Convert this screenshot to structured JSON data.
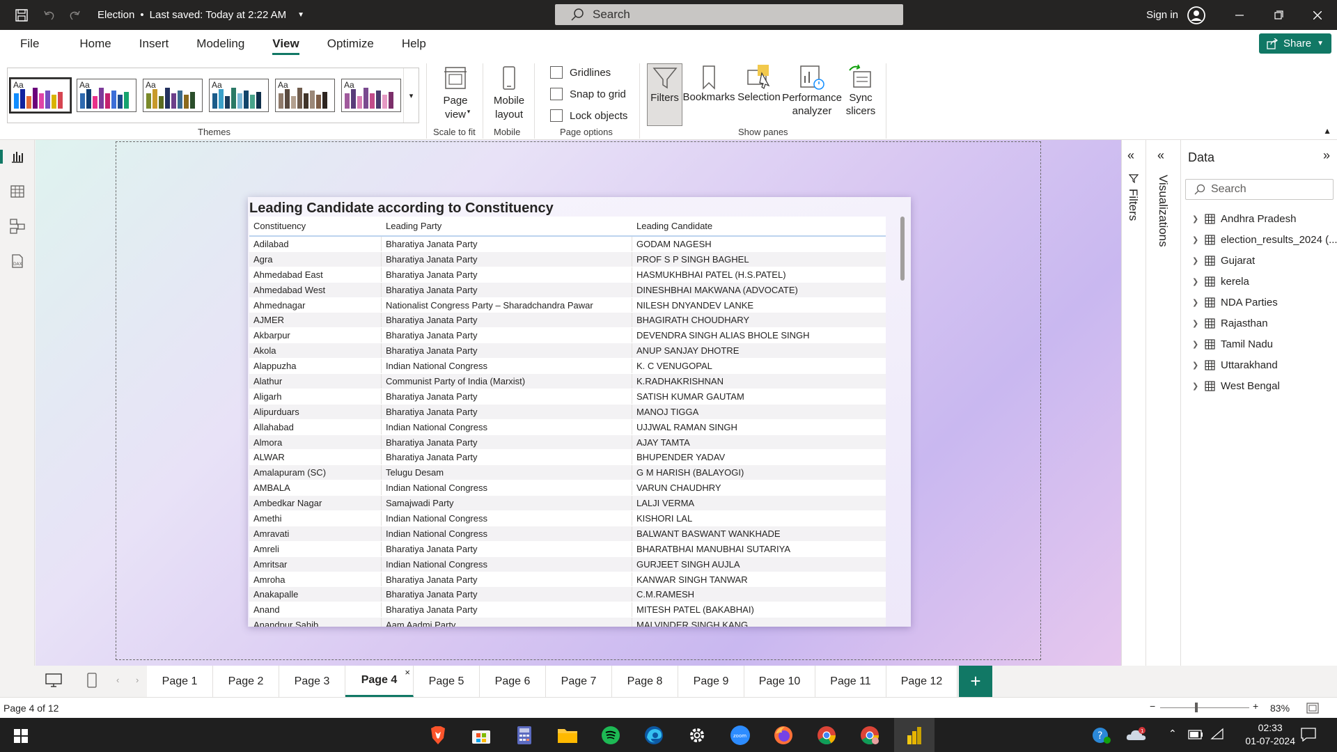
{
  "titlebar": {
    "title": "Election",
    "saved": "Last saved: Today at 2:22 AM",
    "search_placeholder": "Search",
    "signin": "Sign in"
  },
  "menu": {
    "items": [
      "File",
      "Home",
      "Insert",
      "Modeling",
      "View",
      "Optimize",
      "Help"
    ],
    "active": "View",
    "share": "Share"
  },
  "ribbon": {
    "themes_label": "Themes",
    "page_view_label": "Page view",
    "scale_label": "Scale to fit",
    "mobile_layout_label": "Mobile layout",
    "mobile_group_label": "Mobile",
    "gridlines": "Gridlines",
    "snap": "Snap to grid",
    "lock": "Lock objects",
    "page_options_label": "Page options",
    "filters": "Filters",
    "bookmarks": "Bookmarks",
    "selection": "Selection",
    "performance": "Performance analyzer",
    "sync": "Sync slicers",
    "show_panes_label": "Show panes"
  },
  "visual": {
    "title": "Leading Candidate according to Constituency",
    "columns": [
      "Constituency",
      "Leading Party",
      "Leading Candidate"
    ],
    "rows": [
      [
        "Adilabad",
        "Bharatiya Janata Party",
        "GODAM NAGESH"
      ],
      [
        "Agra",
        "Bharatiya Janata Party",
        "PROF S P SINGH BAGHEL"
      ],
      [
        "Ahmedabad East",
        "Bharatiya Janata Party",
        "HASMUKHBHAI PATEL (H.S.PATEL)"
      ],
      [
        "Ahmedabad West",
        "Bharatiya Janata Party",
        "DINESHBHAI MAKWANA (ADVOCATE)"
      ],
      [
        "Ahmednagar",
        "Nationalist Congress Party – Sharadchandra Pawar",
        "NILESH DNYANDEV LANKE"
      ],
      [
        "AJMER",
        "Bharatiya Janata Party",
        "BHAGIRATH CHOUDHARY"
      ],
      [
        "Akbarpur",
        "Bharatiya Janata Party",
        "DEVENDRA SINGH ALIAS BHOLE SINGH"
      ],
      [
        "Akola",
        "Bharatiya Janata Party",
        "ANUP SANJAY DHOTRE"
      ],
      [
        "Alappuzha",
        "Indian National Congress",
        "K. C VENUGOPAL"
      ],
      [
        "Alathur",
        "Communist Party of India (Marxist)",
        "K.RADHAKRISHNAN"
      ],
      [
        "Aligarh",
        "Bharatiya Janata Party",
        "SATISH KUMAR GAUTAM"
      ],
      [
        "Alipurduars",
        "Bharatiya Janata Party",
        "MANOJ TIGGA"
      ],
      [
        "Allahabad",
        "Indian National Congress",
        "UJJWAL RAMAN SINGH"
      ],
      [
        "Almora",
        "Bharatiya Janata Party",
        "AJAY TAMTA"
      ],
      [
        "ALWAR",
        "Bharatiya Janata Party",
        "BHUPENDER YADAV"
      ],
      [
        "Amalapuram (SC)",
        "Telugu Desam",
        "G M HARISH (BALAYOGI)"
      ],
      [
        "AMBALA",
        "Indian National Congress",
        "VARUN CHAUDHRY"
      ],
      [
        "Ambedkar Nagar",
        "Samajwadi Party",
        "LALJI VERMA"
      ],
      [
        "Amethi",
        "Indian National Congress",
        "KISHORI LAL"
      ],
      [
        "Amravati",
        "Indian National Congress",
        "BALWANT BASWANT WANKHADE"
      ],
      [
        "Amreli",
        "Bharatiya Janata Party",
        "BHARATBHAI MANUBHAI SUTARIYA"
      ],
      [
        "Amritsar",
        "Indian National Congress",
        "GURJEET SINGH AUJLA"
      ],
      [
        "Amroha",
        "Bharatiya Janata Party",
        "KANWAR SINGH TANWAR"
      ],
      [
        "Anakapalle",
        "Bharatiya Janata Party",
        "C.M.RAMESH"
      ],
      [
        "Anand",
        "Bharatiya Janata Party",
        "MITESH PATEL (BAKABHAI)"
      ],
      [
        "Anandpur Sahib",
        "Aam Aadmi Party",
        "MALVINDER SINGH KANG"
      ]
    ]
  },
  "panes": {
    "filters": "Filters",
    "visualizations": "Visualizations",
    "data_title": "Data",
    "data_search": "Search",
    "tables": [
      "Andhra Pradesh",
      "election_results_2024 (...",
      "Gujarat",
      "kerela",
      "NDA Parties",
      "Rajasthan",
      "Tamil Nadu",
      "Uttarakhand",
      "West Bengal"
    ]
  },
  "tabs": [
    "Page 1",
    "Page 2",
    "Page 3",
    "Page 4",
    "Page 5",
    "Page 6",
    "Page 7",
    "Page 8",
    "Page 9",
    "Page 10",
    "Page 11",
    "Page 12"
  ],
  "active_tab": "Page 4",
  "status": {
    "page_info": "Page 4 of 12",
    "zoom": "83%"
  },
  "taskbar": {
    "time": "02:33",
    "date": "01-07-2024"
  },
  "colors": {
    "accent": "#117865",
    "titlebar": "#252423"
  }
}
